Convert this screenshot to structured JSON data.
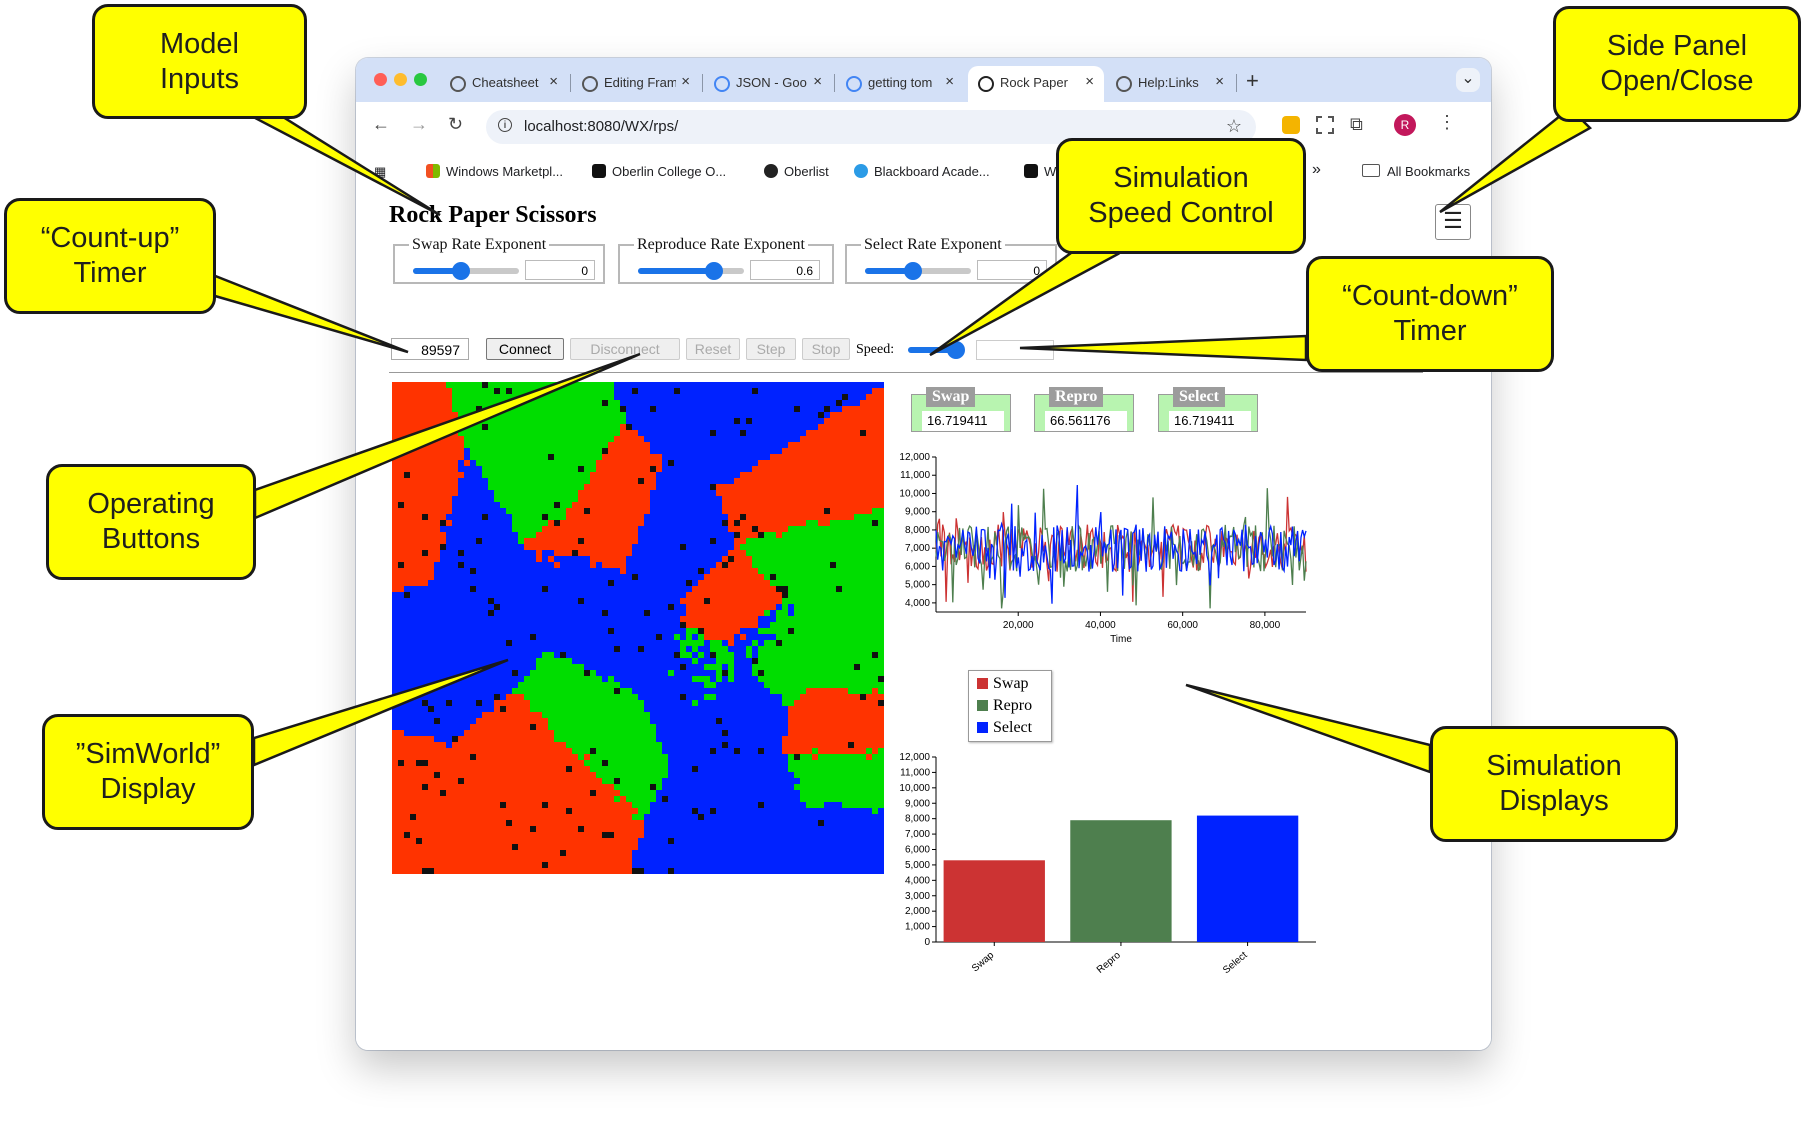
{
  "browser": {
    "tabs": [
      {
        "label": "Cheatsheet",
        "favicon": "cheatsheet-icon"
      },
      {
        "label": "Editing Fram",
        "favicon": "edit-icon"
      },
      {
        "label": "JSON - Goo",
        "favicon": "google-icon"
      },
      {
        "label": "getting tom",
        "favicon": "google-icon"
      },
      {
        "label": "Rock Paper",
        "favicon": "notion-icon",
        "active": true
      },
      {
        "label": "Help:Links",
        "favicon": "wiki-icon"
      }
    ],
    "new_tab": "+",
    "tab_menu": "⌄",
    "close_glyph": "×",
    "url": "localhost:8080/WX/rps/",
    "profile_initial": "R",
    "bookmarks": [
      {
        "label": "Windows Marketpl...",
        "icon": "windows-icon"
      },
      {
        "label": "Oberlin College O...",
        "icon": "o-icon"
      },
      {
        "label": "Oberlist",
        "icon": "github-icon"
      },
      {
        "label": "Blackboard Acade...",
        "icon": "att-icon"
      },
      {
        "label": "W",
        "icon": "o-icon"
      }
    ],
    "bookmarks_overflow": "»",
    "all_bookmarks": "All Bookmarks"
  },
  "app": {
    "title": "Rock Paper Scissors",
    "menu_glyph": "☰",
    "params": [
      {
        "label": "Swap Rate Exponent",
        "value": "0",
        "level": 0.45
      },
      {
        "label": "Reproduce Rate Exponent",
        "value": "0.6",
        "level": 0.72
      },
      {
        "label": "Select Rate Exponent",
        "value": "0",
        "level": 0.45
      }
    ],
    "counter": "89597",
    "buttons": [
      "Connect",
      "Disconnect",
      "Reset",
      "Step",
      "Stop"
    ],
    "speed_label": "Speed:",
    "speed_level": 0.85,
    "countdown": "",
    "stats": [
      {
        "label": "Swap",
        "value": "16.719411"
      },
      {
        "label": "Repro",
        "value": "66.561176"
      },
      {
        "label": "Select",
        "value": "16.719411"
      }
    ]
  },
  "colors": {
    "swap": "#cc3333",
    "repro": "#4e7f4e",
    "select": "#0022ff",
    "world_red": "#ff3300",
    "world_green": "#00dd00",
    "world_blue": "#0022ff",
    "callout": "#ffff00"
  },
  "chart_data": [
    {
      "type": "line",
      "xlabel": "Time",
      "xticks": [
        "20,000",
        "40,000",
        "60,000",
        "80,000"
      ],
      "yticks": [
        "4,000",
        "5,000",
        "6,000",
        "7,000",
        "8,000",
        "9,000",
        "10,000",
        "11,000",
        "12,000"
      ],
      "xlim": [
        0,
        90000
      ],
      "ylim": [
        3500,
        12000
      ],
      "series": [
        {
          "name": "Swap",
          "mean": 7000,
          "range": [
            3600,
            11500
          ]
        },
        {
          "name": "Repro",
          "mean": 7000,
          "range": [
            3700,
            12000
          ]
        },
        {
          "name": "Select",
          "mean": 7000,
          "range": [
            3600,
            11000
          ]
        }
      ]
    },
    {
      "type": "bar",
      "categories": [
        "Swap",
        "Repro",
        "Select"
      ],
      "values": [
        5300,
        7900,
        8200
      ],
      "yticks": [
        "0",
        "1,000",
        "2,000",
        "3,000",
        "4,000",
        "5,000",
        "6,000",
        "7,000",
        "8,000",
        "9,000",
        "10,000",
        "11,000",
        "12,000"
      ],
      "ylim": [
        0,
        12000
      ],
      "legend": [
        "Swap",
        "Repro",
        "Select"
      ]
    }
  ],
  "callouts": {
    "model_inputs": "Model\nInputs",
    "side_panel": "Side Panel\nOpen/Close",
    "count_up": "“Count-up”\nTimer",
    "speed_control": "Simulation\nSpeed Control",
    "count_down": "“Count-down”\nTimer",
    "operating_buttons": "Operating\nButtons",
    "simworld": "”SimWorld”\nDisplay",
    "sim_displays": "Simulation\nDisplays"
  }
}
